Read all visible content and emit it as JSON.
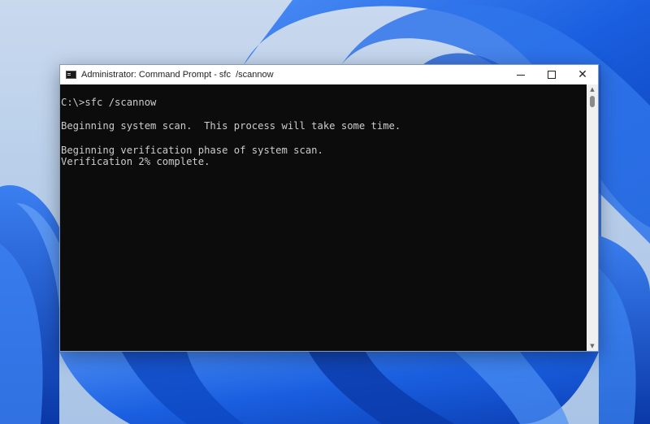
{
  "window": {
    "title": "Administrator: Command Prompt - sfc  /scannow",
    "icon": "cmd-icon",
    "controls": {
      "minimize_icon": "minimize-icon",
      "maximize_icon": "maximize-icon",
      "close_icon": "close-icon",
      "close_glyph": "✕"
    }
  },
  "console": {
    "lines": [
      "C:\\>sfc /scannow",
      "",
      "Beginning system scan.  This process will take some time.",
      "",
      "Beginning verification phase of system scan.",
      "Verification 2% complete."
    ],
    "background": "#0c0c0c",
    "foreground": "#cccccc"
  },
  "colors": {
    "wallpaper_blue": "#1a5fe0",
    "wallpaper_bg": "#b9cfea"
  }
}
